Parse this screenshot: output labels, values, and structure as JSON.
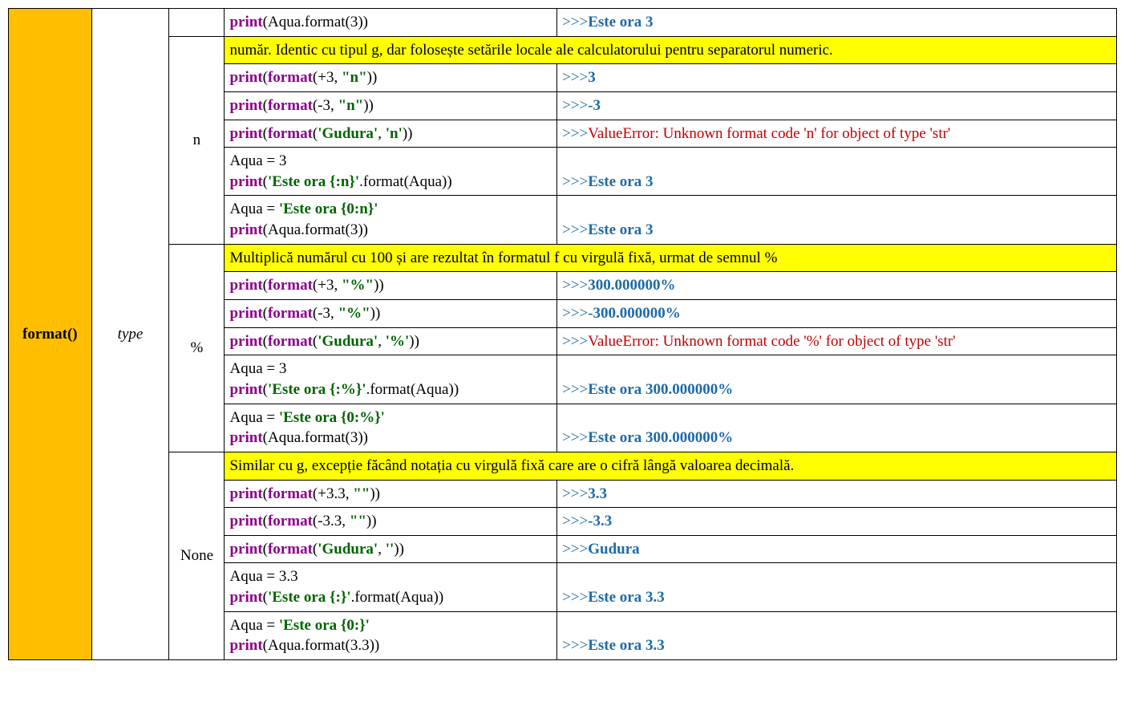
{
  "header": {
    "func": "format()",
    "param": "type"
  },
  "sections": [
    {
      "spec": "",
      "rows": [
        {
          "code": [
            [
              {
                "t": "print",
                "c": "kw"
              },
              {
                "t": "(Aqua.format(3))",
                "c": "plain"
              }
            ]
          ],
          "out": {
            "prompt": ">>>",
            "value": "Este ora 3",
            "kind": "res"
          }
        }
      ]
    },
    {
      "spec": "n",
      "desc": "număr. Identic cu tipul g, dar folosește setările locale ale calculatorului pentru separatorul numeric.",
      "rows": [
        {
          "code": [
            [
              {
                "t": "print",
                "c": "kw"
              },
              {
                "t": "(",
                "c": "plain"
              },
              {
                "t": "format",
                "c": "kw"
              },
              {
                "t": "(+3, ",
                "c": "plain"
              },
              {
                "t": "\"n\"",
                "c": "str"
              },
              {
                "t": "))",
                "c": "plain"
              }
            ]
          ],
          "out": {
            "prompt": ">>>",
            "value": "3",
            "kind": "res"
          }
        },
        {
          "code": [
            [
              {
                "t": "print",
                "c": "kw"
              },
              {
                "t": "(",
                "c": "plain"
              },
              {
                "t": "format",
                "c": "kw"
              },
              {
                "t": "(-3, ",
                "c": "plain"
              },
              {
                "t": "\"n\"",
                "c": "str"
              },
              {
                "t": "))",
                "c": "plain"
              }
            ]
          ],
          "out": {
            "prompt": ">>>",
            "value": "-3",
            "kind": "res"
          }
        },
        {
          "code": [
            [
              {
                "t": "print",
                "c": "kw"
              },
              {
                "t": "(",
                "c": "plain"
              },
              {
                "t": "format",
                "c": "kw"
              },
              {
                "t": "(",
                "c": "plain"
              },
              {
                "t": "'Gudura'",
                "c": "str"
              },
              {
                "t": ", ",
                "c": "plain"
              },
              {
                "t": "'n'",
                "c": "str"
              },
              {
                "t": "))",
                "c": "plain"
              }
            ]
          ],
          "out": {
            "prompt": ">>>",
            "value": "ValueError: Unknown format code 'n' for object of type 'str'",
            "kind": "err"
          }
        },
        {
          "code": [
            [
              {
                "t": "Aqua = 3",
                "c": "plain"
              }
            ],
            [
              {
                "t": "print",
                "c": "kw"
              },
              {
                "t": "(",
                "c": "plain"
              },
              {
                "t": "'Este ora {:n}'",
                "c": "str"
              },
              {
                "t": ".format(Aqua))",
                "c": "plain"
              }
            ]
          ],
          "out": {
            "prompt": ">>>",
            "value": "Este ora 3",
            "kind": "res"
          }
        },
        {
          "code": [
            [
              {
                "t": "Aqua = ",
                "c": "plain"
              },
              {
                "t": "'Este ora {0:n}'",
                "c": "str"
              }
            ],
            [
              {
                "t": "print",
                "c": "kw"
              },
              {
                "t": "(Aqua.format(3))",
                "c": "plain"
              }
            ]
          ],
          "out": {
            "prompt": ">>>",
            "value": "Este ora 3",
            "kind": "res"
          }
        }
      ]
    },
    {
      "spec": "%",
      "desc": "Multiplică numărul cu 100 și are rezultat în formatul f cu virgulă fixă, urmat de semnul %",
      "rows": [
        {
          "code": [
            [
              {
                "t": "print",
                "c": "kw"
              },
              {
                "t": "(",
                "c": "plain"
              },
              {
                "t": "format",
                "c": "kw"
              },
              {
                "t": "(+3, ",
                "c": "plain"
              },
              {
                "t": "\"%\"",
                "c": "str"
              },
              {
                "t": "))",
                "c": "plain"
              }
            ]
          ],
          "out": {
            "prompt": ">>>",
            "value": "300.000000%",
            "kind": "res"
          }
        },
        {
          "code": [
            [
              {
                "t": "print",
                "c": "kw"
              },
              {
                "t": "(",
                "c": "plain"
              },
              {
                "t": "format",
                "c": "kw"
              },
              {
                "t": "(-3, ",
                "c": "plain"
              },
              {
                "t": "\"%\"",
                "c": "str"
              },
              {
                "t": "))",
                "c": "plain"
              }
            ]
          ],
          "out": {
            "prompt": ">>>",
            "value": "-300.000000%",
            "kind": "res"
          }
        },
        {
          "code": [
            [
              {
                "t": "print",
                "c": "kw"
              },
              {
                "t": "(",
                "c": "plain"
              },
              {
                "t": "format",
                "c": "kw"
              },
              {
                "t": "(",
                "c": "plain"
              },
              {
                "t": "'Gudura'",
                "c": "str"
              },
              {
                "t": ", ",
                "c": "plain"
              },
              {
                "t": "'%'",
                "c": "str"
              },
              {
                "t": "))",
                "c": "plain"
              }
            ]
          ],
          "out": {
            "prompt": ">>>",
            "value": "ValueError: Unknown format code '%' for object of type 'str'",
            "kind": "err"
          }
        },
        {
          "code": [
            [
              {
                "t": "Aqua = 3",
                "c": "plain"
              }
            ],
            [
              {
                "t": "print",
                "c": "kw"
              },
              {
                "t": "(",
                "c": "plain"
              },
              {
                "t": "'Este ora {:%}'",
                "c": "str"
              },
              {
                "t": ".format(Aqua))",
                "c": "plain"
              }
            ]
          ],
          "out": {
            "prompt": ">>>",
            "value": "Este ora 300.000000%",
            "kind": "res"
          }
        },
        {
          "code": [
            [
              {
                "t": "Aqua = ",
                "c": "plain"
              },
              {
                "t": "'Este ora {0:%}'",
                "c": "str"
              }
            ],
            [
              {
                "t": "print",
                "c": "kw"
              },
              {
                "t": "(Aqua.format(3))",
                "c": "plain"
              }
            ]
          ],
          "out": {
            "prompt": ">>>",
            "value": "Este ora 300.000000%",
            "kind": "res"
          }
        }
      ]
    },
    {
      "spec": "None",
      "desc": "Similar cu g, excepție făcând notația cu virgulă fixă care are o cifră lângă valoarea decimală.",
      "rows": [
        {
          "code": [
            [
              {
                "t": "print",
                "c": "kw"
              },
              {
                "t": "(",
                "c": "plain"
              },
              {
                "t": "format",
                "c": "kw"
              },
              {
                "t": "(+3.3, ",
                "c": "plain"
              },
              {
                "t": "\"\"",
                "c": "str"
              },
              {
                "t": "))",
                "c": "plain"
              }
            ]
          ],
          "out": {
            "prompt": ">>>",
            "value": "3.3",
            "kind": "res"
          }
        },
        {
          "code": [
            [
              {
                "t": "print",
                "c": "kw"
              },
              {
                "t": "(",
                "c": "plain"
              },
              {
                "t": "format",
                "c": "kw"
              },
              {
                "t": "(-3.3, ",
                "c": "plain"
              },
              {
                "t": "\"\"",
                "c": "str"
              },
              {
                "t": "))",
                "c": "plain"
              }
            ]
          ],
          "out": {
            "prompt": ">>>",
            "value": "-3.3",
            "kind": "res"
          }
        },
        {
          "code": [
            [
              {
                "t": "print",
                "c": "kw"
              },
              {
                "t": "(",
                "c": "plain"
              },
              {
                "t": "format",
                "c": "kw"
              },
              {
                "t": "(",
                "c": "plain"
              },
              {
                "t": "'Gudura'",
                "c": "str"
              },
              {
                "t": ", ",
                "c": "plain"
              },
              {
                "t": "''",
                "c": "str"
              },
              {
                "t": "))",
                "c": "plain"
              }
            ]
          ],
          "out": {
            "prompt": ">>>",
            "value": "Gudura",
            "kind": "res"
          }
        },
        {
          "code": [
            [
              {
                "t": "Aqua = 3.3",
                "c": "plain"
              }
            ],
            [
              {
                "t": "print",
                "c": "kw"
              },
              {
                "t": "(",
                "c": "plain"
              },
              {
                "t": "'Este ora {:}'",
                "c": "str"
              },
              {
                "t": ".format(Aqua))",
                "c": "plain"
              }
            ]
          ],
          "out": {
            "prompt": ">>>",
            "value": "Este ora 3.3",
            "kind": "res"
          }
        },
        {
          "code": [
            [
              {
                "t": "Aqua = ",
                "c": "plain"
              },
              {
                "t": "'Este ora {0:}'",
                "c": "str"
              }
            ],
            [
              {
                "t": "print",
                "c": "kw"
              },
              {
                "t": "(Aqua.format(3.3))",
                "c": "plain"
              }
            ]
          ],
          "out": {
            "prompt": ">>>",
            "value": "Este ora 3.3",
            "kind": "res"
          }
        }
      ]
    }
  ]
}
